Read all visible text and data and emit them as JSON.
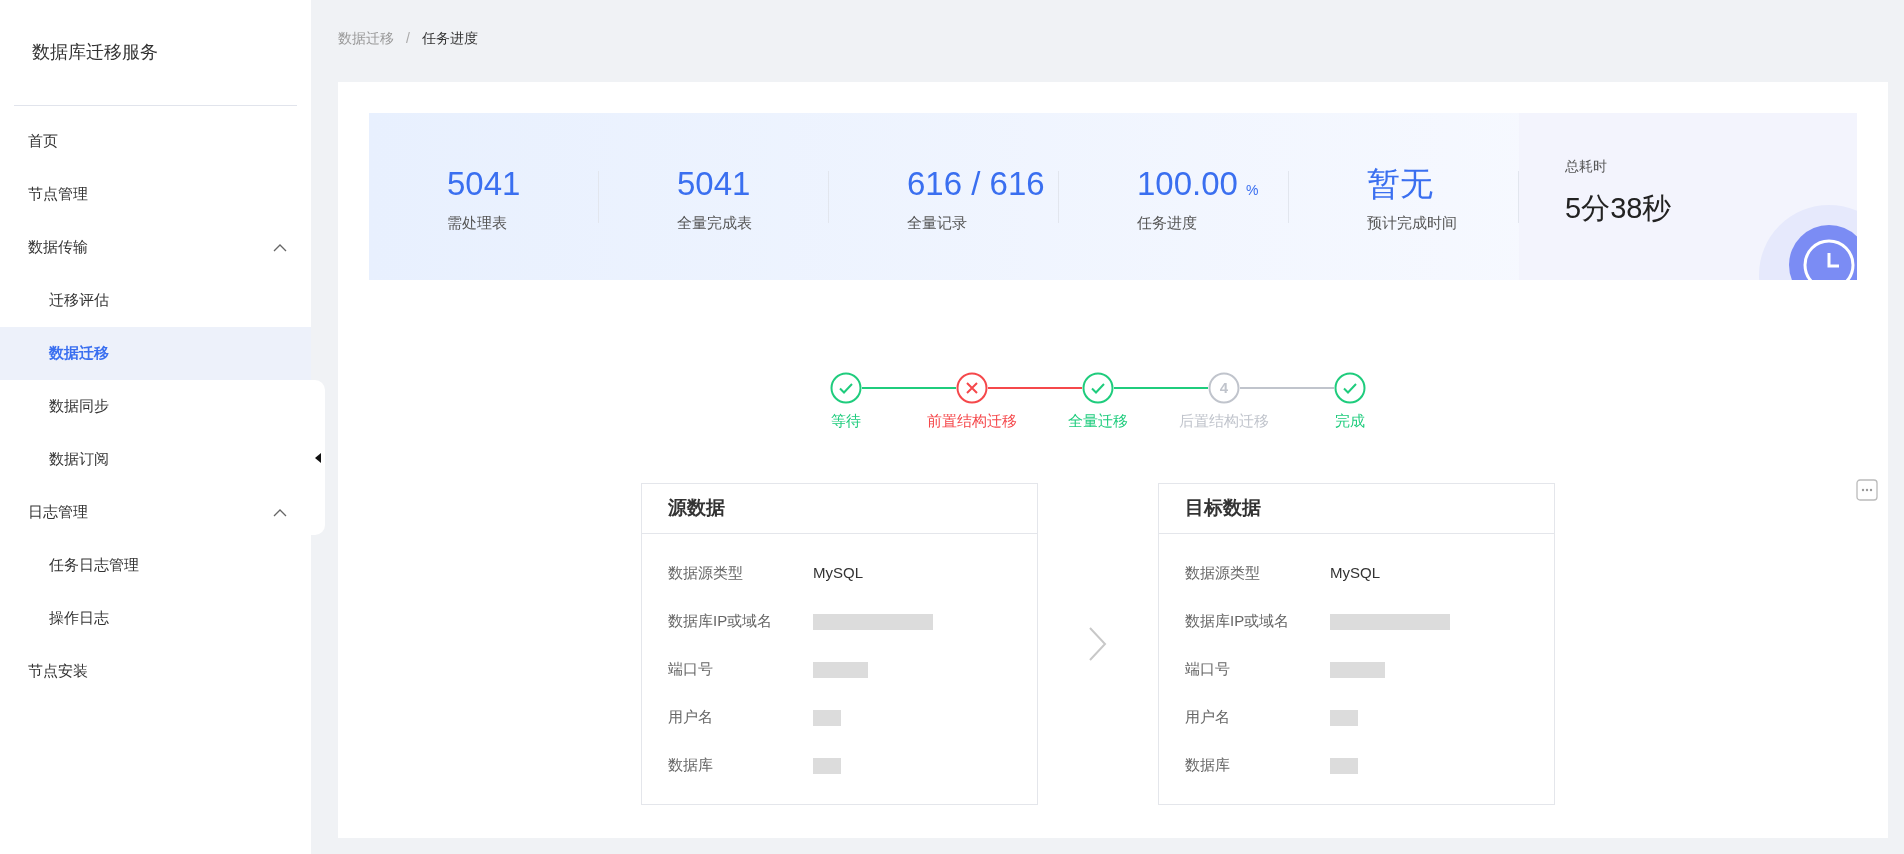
{
  "app_title": "数据库迁移服务",
  "sidebar": {
    "items": [
      {
        "label": "首页",
        "selected": false
      },
      {
        "label": "节点管理",
        "selected": false
      },
      {
        "label": "数据传输",
        "selected": false,
        "expanded": true,
        "children": [
          {
            "label": "迁移评估",
            "selected": false
          },
          {
            "label": "数据迁移",
            "selected": true
          },
          {
            "label": "数据同步",
            "selected": false
          },
          {
            "label": "数据订阅",
            "selected": false
          }
        ]
      },
      {
        "label": "日志管理",
        "selected": false,
        "expanded": true,
        "children": [
          {
            "label": "任务日志管理",
            "selected": false
          },
          {
            "label": "操作日志",
            "selected": false
          }
        ]
      },
      {
        "label": "节点安装",
        "selected": false
      }
    ]
  },
  "breadcrumb": [
    "数据迁移",
    "任务进度"
  ],
  "breadcrumb_separator": "/",
  "stats": [
    {
      "value": "5041",
      "label": "需处理表"
    },
    {
      "value": "5041",
      "label": "全量完成表"
    },
    {
      "value": "616 / 616",
      "label": "全量记录"
    },
    {
      "value": "100.00",
      "unit": "%",
      "label": "任务进度"
    },
    {
      "value": "暂无",
      "label": "预计完成时间"
    }
  ],
  "elapsed": {
    "label": "总耗时",
    "value": "5分38秒"
  },
  "steps": [
    {
      "label": "等待",
      "kind": "check",
      "color": "#1fcc7d"
    },
    {
      "label": "前置结构迁移",
      "kind": "cross",
      "color": "#f5484b"
    },
    {
      "label": "全量迁移",
      "kind": "check",
      "color": "#1fcc7d"
    },
    {
      "label": "后置结构迁移",
      "kind": "number",
      "number": "4",
      "color": "#c0c4cc"
    },
    {
      "label": "完成",
      "kind": "check",
      "color": "#1fcc7d"
    }
  ],
  "source": {
    "title": "源数据",
    "fields": [
      {
        "label": "数据源类型",
        "value": "MySQL"
      },
      {
        "label": "数据库IP或域名",
        "redacted": true
      },
      {
        "label": "端口号",
        "redacted": true
      },
      {
        "label": "用户名",
        "redacted": true
      },
      {
        "label": "数据库",
        "redacted": true
      }
    ]
  },
  "target": {
    "title": "目标数据",
    "fields": [
      {
        "label": "数据源类型",
        "value": "MySQL"
      },
      {
        "label": "数据库IP或域名",
        "redacted": true
      },
      {
        "label": "端口号",
        "redacted": true
      },
      {
        "label": "用户名",
        "redacted": true
      },
      {
        "label": "数据库",
        "redacted": true
      }
    ]
  }
}
